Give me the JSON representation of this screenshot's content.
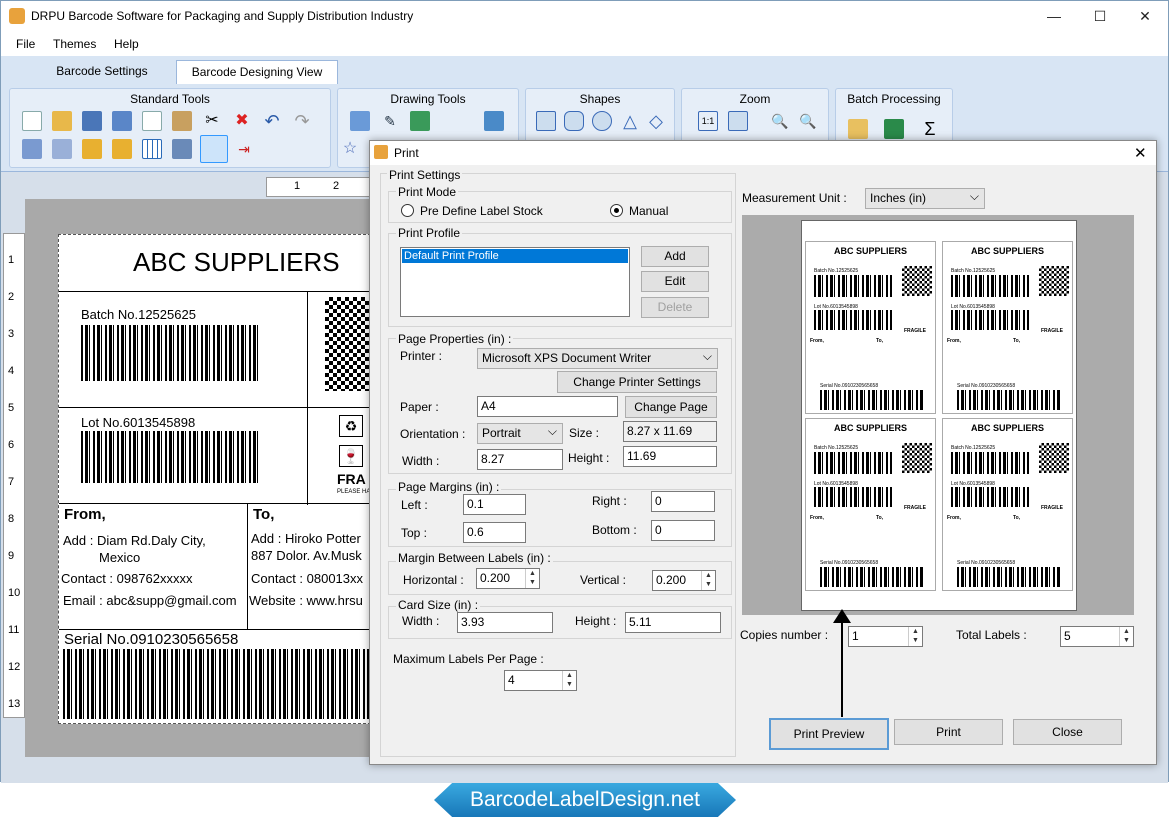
{
  "window": {
    "title": "DRPU Barcode Software for Packaging and Supply Distribution Industry"
  },
  "menu": [
    "File",
    "Themes",
    "Help"
  ],
  "tabs": [
    "Barcode Settings",
    "Barcode Designing View"
  ],
  "ribbon": {
    "groups": [
      "Standard Tools",
      "Drawing Tools",
      "Shapes",
      "Zoom",
      "Batch Processing"
    ]
  },
  "ruler": {
    "h": [
      "1",
      "2"
    ],
    "v": [
      "1",
      "2",
      "3",
      "4",
      "5",
      "6",
      "7",
      "8",
      "9",
      "10",
      "11",
      "12",
      "13"
    ]
  },
  "label": {
    "title": "ABC SUPPLIERS",
    "batch": "Batch No.12525625",
    "lot": "Lot No.6013545898",
    "from_heading": "From,",
    "from_addr1": "Add : Diam Rd.Daly City,",
    "from_addr2": "Mexico",
    "from_contact": "Contact : 098762xxxxx",
    "from_email": "Email : abc&supp@gmail.com",
    "to_heading": "To,",
    "to_addr1": "Add : Hiroko Potter",
    "to_addr2": "887  Dolor. Av.Musk",
    "to_contact": "Contact : 080013xx",
    "to_website": "Website : www.hrsu",
    "serial": "Serial No.0910230565658",
    "fragile": "FRA",
    "fragile_sub": "PLEASE HAN"
  },
  "dialog": {
    "title": "Print",
    "print_settings": "Print Settings",
    "print_mode": "Print Mode",
    "mode_predefine": "Pre Define Label Stock",
    "mode_manual": "Manual",
    "print_profile": "Print Profile",
    "profile_item": "Default Print Profile",
    "add": "Add",
    "edit": "Edit",
    "delete": "Delete",
    "page_properties": "Page Properties (in) :",
    "printer_label": "Printer :",
    "printer_value": "Microsoft XPS Document Writer",
    "change_printer": "Change Printer Settings",
    "paper_label": "Paper :",
    "paper_value": "A4",
    "change_page": "Change Page",
    "orientation_label": "Orientation :",
    "orientation_value": "Portrait",
    "size_label": "Size :",
    "size_value": "8.27 x 11.69",
    "width_label": "Width :",
    "width_value": "8.27",
    "height_label": "Height :",
    "height_value": "11.69",
    "page_margins": "Page Margins (in) :",
    "left_label": "Left :",
    "left_value": "0.1",
    "right_label": "Right :",
    "right_value": "0",
    "top_label": "Top :",
    "top_value": "0.6",
    "bottom_label": "Bottom :",
    "bottom_value": "0",
    "margin_between": "Margin Between Labels (in) :",
    "horizontal_label": "Horizontal :",
    "horizontal_value": "0.200",
    "vertical_label": "Vertical :",
    "vertical_value": "0.200",
    "card_size": "Card Size (in) :",
    "card_width_label": "Width :",
    "card_width_value": "3.93",
    "card_height_label": "Height :",
    "card_height_value": "5.11",
    "max_labels": "Maximum Labels Per Page :",
    "max_labels_value": "4",
    "measurement_label": "Measurement Unit :",
    "measurement_value": "Inches (in)",
    "copies_label": "Copies number :",
    "copies_value": "1",
    "total_label": "Total Labels :",
    "total_value": "5",
    "print_preview": "Print Preview",
    "print": "Print",
    "close": "Close"
  },
  "preview_label": {
    "title": "ABC SUPPLIERS",
    "batch": "Batch No.12525625",
    "lot": "Lot No.6013545898",
    "from": "From,",
    "to": "To,",
    "addr_from": "Add : Diam Rd.Daly City, Mexico",
    "addr_to": "Add : Hiroko Potter P.O. Box 887 Dolor. Av.Muskegan",
    "contact_from": "Contact : 098762xxxxx",
    "contact_to": "Contact : 080013xxxx",
    "email": "Email : abcksupp@gmail.com",
    "website": "Website : www.hrsupplier.com",
    "serial": "Serial No.0910230565658",
    "fragile": "FRAGILE"
  },
  "brand": "BarcodeLabelDesign.net",
  "colors": {
    "accent": "#3399ff",
    "ribbon": "#d8e5f4",
    "selection": "#0078d7"
  }
}
